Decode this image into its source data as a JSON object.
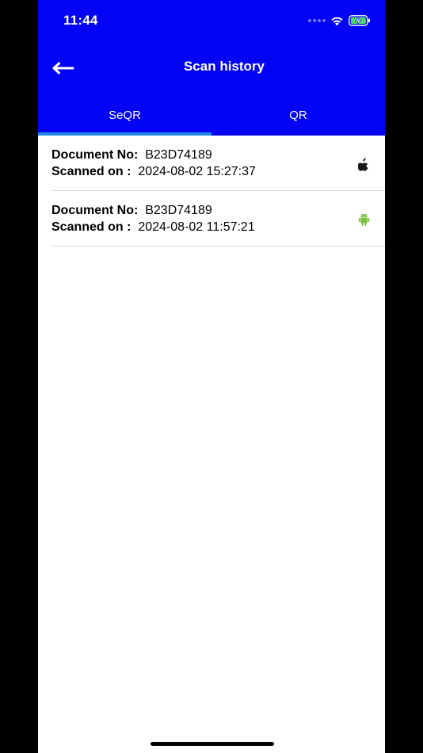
{
  "status_bar": {
    "time": "11:44",
    "icons": [
      "signal-icon",
      "wifi-icon",
      "battery-charging-icon"
    ]
  },
  "header": {
    "title": "Scan history",
    "back_icon": "arrow-left-icon"
  },
  "tabs": [
    {
      "label": "SeQR",
      "selected": true
    },
    {
      "label": "QR",
      "selected": false
    }
  ],
  "history": [
    {
      "doc_label": "Document No:",
      "doc_value": "B23D74189",
      "scan_label": "Scanned on :",
      "scan_value": "2024-08-02 15:27:37",
      "platform_icon": "apple-icon"
    },
    {
      "doc_label": "Document No:",
      "doc_value": "B23D74189",
      "scan_label": "Scanned on :",
      "scan_value": "2024-08-02 11:57:21",
      "platform_icon": "android-icon"
    }
  ],
  "colors": {
    "header_bg": "#0202f5",
    "tab_indicator": "#1e88e5",
    "android_green": "#7cc243",
    "apple_dark": "#1a1a1a"
  }
}
